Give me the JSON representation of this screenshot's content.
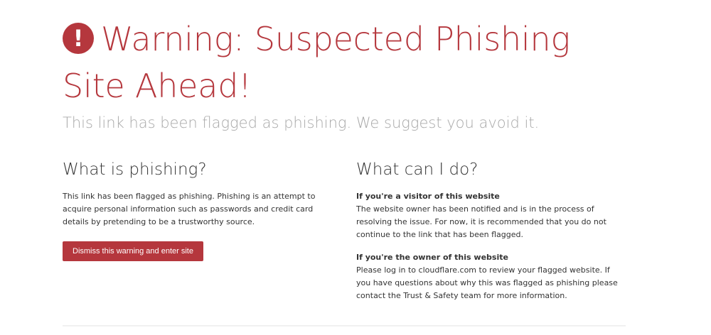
{
  "header": {
    "icon": "exclamation-circle-icon",
    "icon_glyph": "!",
    "title_line1": "Warning: Suspected Phishing",
    "title_line2": "Site Ahead!",
    "subtitle": "This link has been flagged as phishing. We suggest you avoid it."
  },
  "left": {
    "heading": "What is phishing?",
    "body": "This link has been flagged as phishing. Phishing is an attempt to acquire personal information such as passwords and credit card details by pretending to be a trustworthy source.",
    "button_label": "Dismiss this warning and enter site"
  },
  "right": {
    "heading": "What can I do?",
    "visitor_title": "If you're a visitor of this website",
    "visitor_body": "The website owner has been notified and is in the process of resolving the issue. For now, it is recommended that you do not continue to the link that has been flagged.",
    "owner_title": "If you're the owner of this website",
    "owner_body": "Please log in to cloudflare.com to review your flagged website. If you have questions about why this was flagged as phishing please contact the Trust & Safety team for more information."
  },
  "colors": {
    "accent": "#b5373d",
    "subtitle_gray": "#a9a9a9",
    "text": "#333333"
  }
}
